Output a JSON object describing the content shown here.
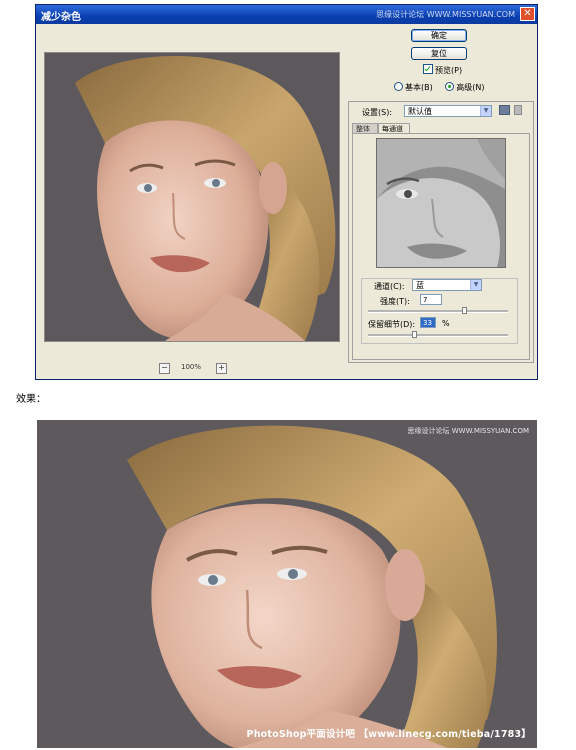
{
  "dialog": {
    "title": "减少杂色",
    "watermark": "思缘设计论坛 WWW.MISSYUAN.COM",
    "close_icon": "close-icon",
    "ok_label": "确定",
    "reset_label": "复位",
    "preview_check": {
      "label": "预览(P)",
      "checked": true
    },
    "mode": {
      "basic_label": "基本(B)",
      "advanced_label": "高级(N)",
      "selected": "advanced"
    },
    "zoom": {
      "minus": "−",
      "value": "100%",
      "plus": "+"
    },
    "settings": {
      "label": "设置(S):",
      "value": "默认值",
      "save_icon": "save-settings-icon",
      "delete_icon": "trash-icon"
    },
    "tabs": [
      {
        "label": "整体",
        "active": false
      },
      {
        "label": "每通道",
        "active": true
      }
    ],
    "channel": {
      "label": "通道(C):",
      "value": "蓝"
    },
    "strength": {
      "label": "强度(T):",
      "value": "7"
    },
    "preserve": {
      "label": "保留细节(D):",
      "value": "33",
      "unit": "%"
    }
  },
  "effect_label": "效果：",
  "result": {
    "watermark": "思缘设计论坛 WWW.MISSYUAN.COM",
    "banner": "PhotoShop平面设计吧 【www.linecg.com/tieba/1783】"
  },
  "colors": {
    "titlebar": "#0a3fb0",
    "dialog_bg": "#ece9d8",
    "photo_bg": "#5e595d",
    "accent_check": "#21a121"
  }
}
